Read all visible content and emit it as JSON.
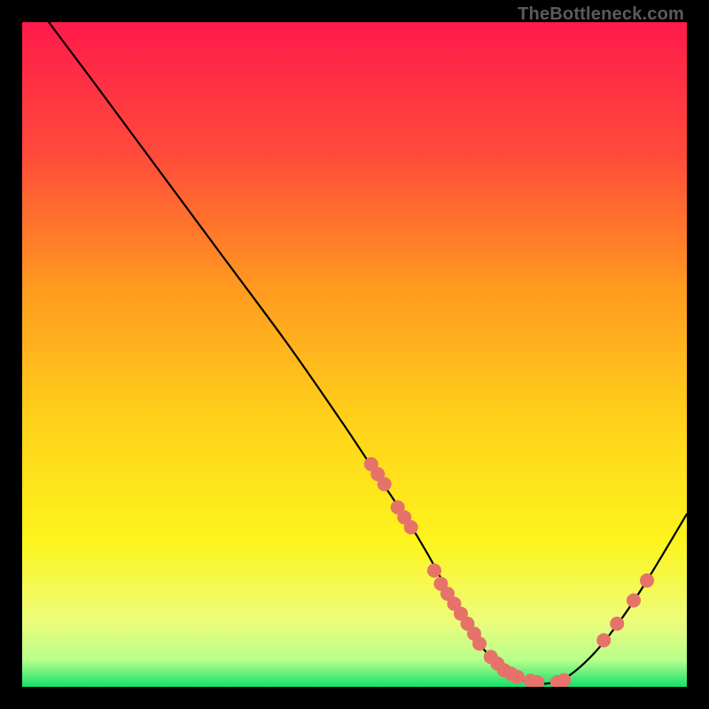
{
  "watermark": {
    "text": "TheBottleneck.com"
  },
  "chart_data": {
    "type": "line",
    "title": "",
    "xlabel": "",
    "ylabel": "",
    "xlim": [
      0,
      100
    ],
    "ylim": [
      0,
      100
    ],
    "grid": false,
    "legend": false,
    "background_gradient_stops": [
      {
        "offset": 0.0,
        "color": "#ff1a4b"
      },
      {
        "offset": 0.2,
        "color": "#ff4b3a"
      },
      {
        "offset": 0.4,
        "color": "#ff9a1f"
      },
      {
        "offset": 0.6,
        "color": "#ffd21a"
      },
      {
        "offset": 0.78,
        "color": "#fdf41c"
      },
      {
        "offset": 0.9,
        "color": "#eefc7a"
      },
      {
        "offset": 0.96,
        "color": "#b8ff8c"
      },
      {
        "offset": 1.0,
        "color": "#14e06a"
      }
    ],
    "series": [
      {
        "name": "curve",
        "x": [
          4,
          10,
          20,
          30,
          40,
          48,
          52,
          55,
          58,
          61,
          64,
          67,
          70,
          73,
          76,
          79,
          82,
          86,
          90,
          94,
          100
        ],
        "y": [
          100,
          92,
          78.5,
          65,
          51.5,
          40,
          34,
          29.5,
          25,
          20,
          14.5,
          9,
          5,
          2.2,
          0.8,
          0.5,
          1.5,
          5,
          10,
          16,
          26
        ]
      }
    ],
    "scatter_points": {
      "name": "highlighted-points",
      "color": "#e57369",
      "radius": 8,
      "points": [
        {
          "x": 52.5,
          "y": 33.5
        },
        {
          "x": 53.5,
          "y": 32.0
        },
        {
          "x": 54.5,
          "y": 30.5
        },
        {
          "x": 56.5,
          "y": 27.0
        },
        {
          "x": 57.5,
          "y": 25.5
        },
        {
          "x": 58.5,
          "y": 24.0
        },
        {
          "x": 62.0,
          "y": 17.5
        },
        {
          "x": 63.0,
          "y": 15.5
        },
        {
          "x": 64.0,
          "y": 14.0
        },
        {
          "x": 65.0,
          "y": 12.5
        },
        {
          "x": 66.0,
          "y": 11.0
        },
        {
          "x": 67.0,
          "y": 9.5
        },
        {
          "x": 68.0,
          "y": 8.0
        },
        {
          "x": 68.8,
          "y": 6.5
        },
        {
          "x": 70.5,
          "y": 4.5
        },
        {
          "x": 71.5,
          "y": 3.5
        },
        {
          "x": 72.5,
          "y": 2.5
        },
        {
          "x": 73.5,
          "y": 2.0
        },
        {
          "x": 74.5,
          "y": 1.5
        },
        {
          "x": 76.5,
          "y": 0.9
        },
        {
          "x": 77.5,
          "y": 0.7
        },
        {
          "x": 80.5,
          "y": 0.7
        },
        {
          "x": 81.5,
          "y": 1.0
        },
        {
          "x": 87.5,
          "y": 7.0
        },
        {
          "x": 89.5,
          "y": 9.5
        },
        {
          "x": 92.0,
          "y": 13.0
        },
        {
          "x": 94.0,
          "y": 16.0
        }
      ]
    }
  }
}
